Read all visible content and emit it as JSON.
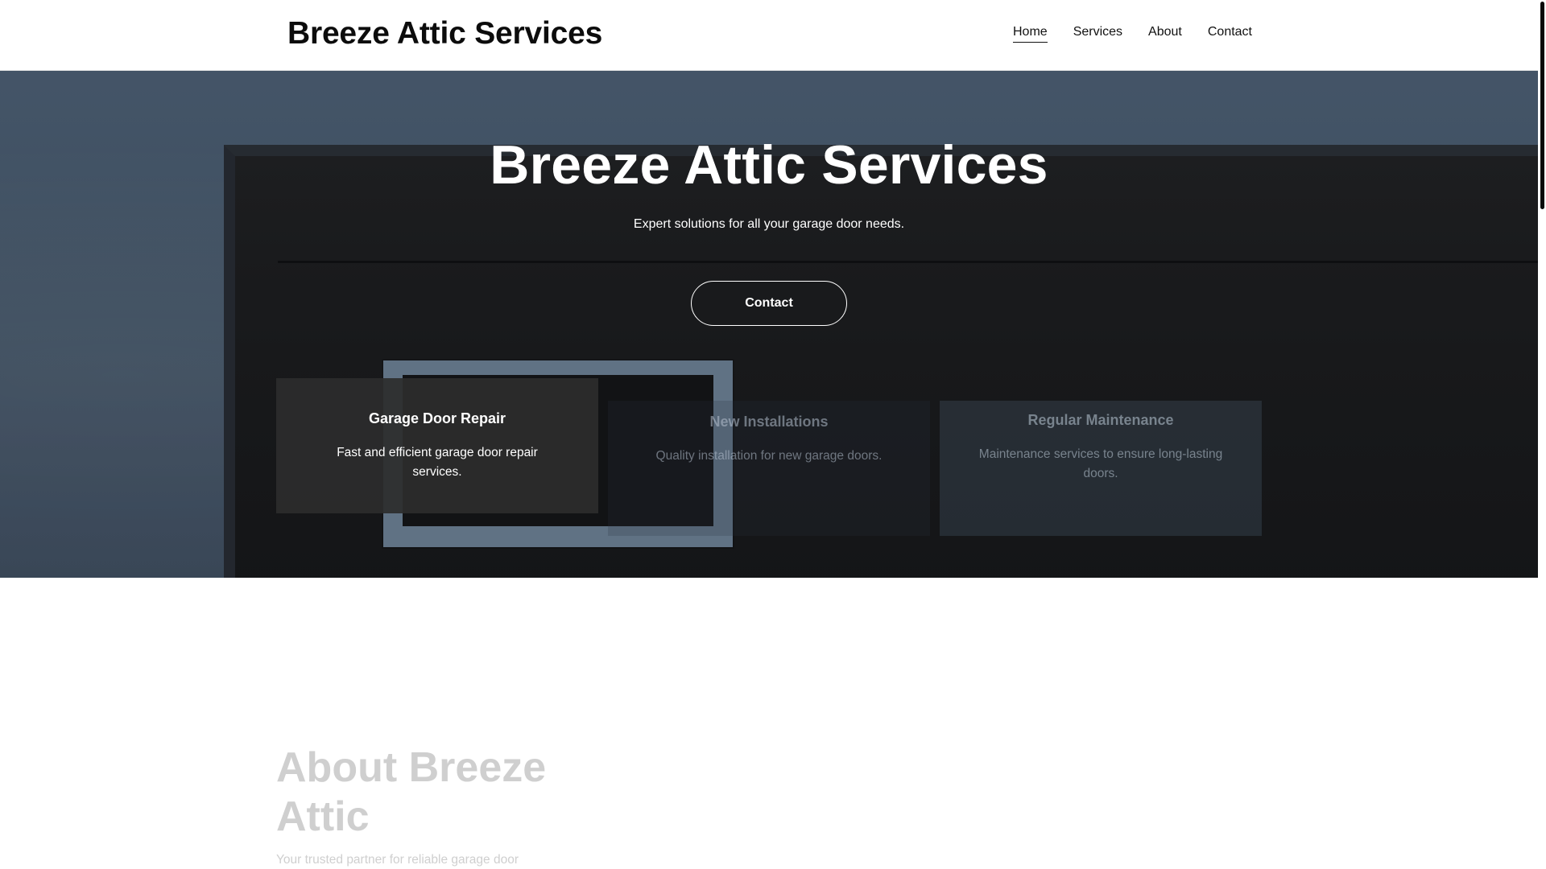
{
  "header": {
    "brand": "Breeze Attic Services",
    "nav": [
      {
        "label": "Home",
        "active": true
      },
      {
        "label": "Services",
        "active": false
      },
      {
        "label": "About",
        "active": false
      },
      {
        "label": "Contact",
        "active": false
      }
    ]
  },
  "hero": {
    "title": "Breeze Attic Services",
    "subtitle": "Expert solutions for all your garage door needs.",
    "cta_label": "Contact"
  },
  "services": [
    {
      "title": "Garage Door Repair",
      "text": "Fast and efficient garage door repair services."
    },
    {
      "title": "New Installations",
      "text": "Quality installation for new garage doors."
    },
    {
      "title": "Regular Maintenance",
      "text": "Maintenance services to ensure long-lasting doors."
    }
  ],
  "about": {
    "title": "About Breeze Attic",
    "text": "Your trusted partner for reliable garage door"
  },
  "colors": {
    "header_bg": "#ffffff",
    "hero_wall": "#4a5a6c",
    "door": "#1a1a1a",
    "card_active": "#2d2d2d",
    "muted_text": "#cfcfcf"
  }
}
